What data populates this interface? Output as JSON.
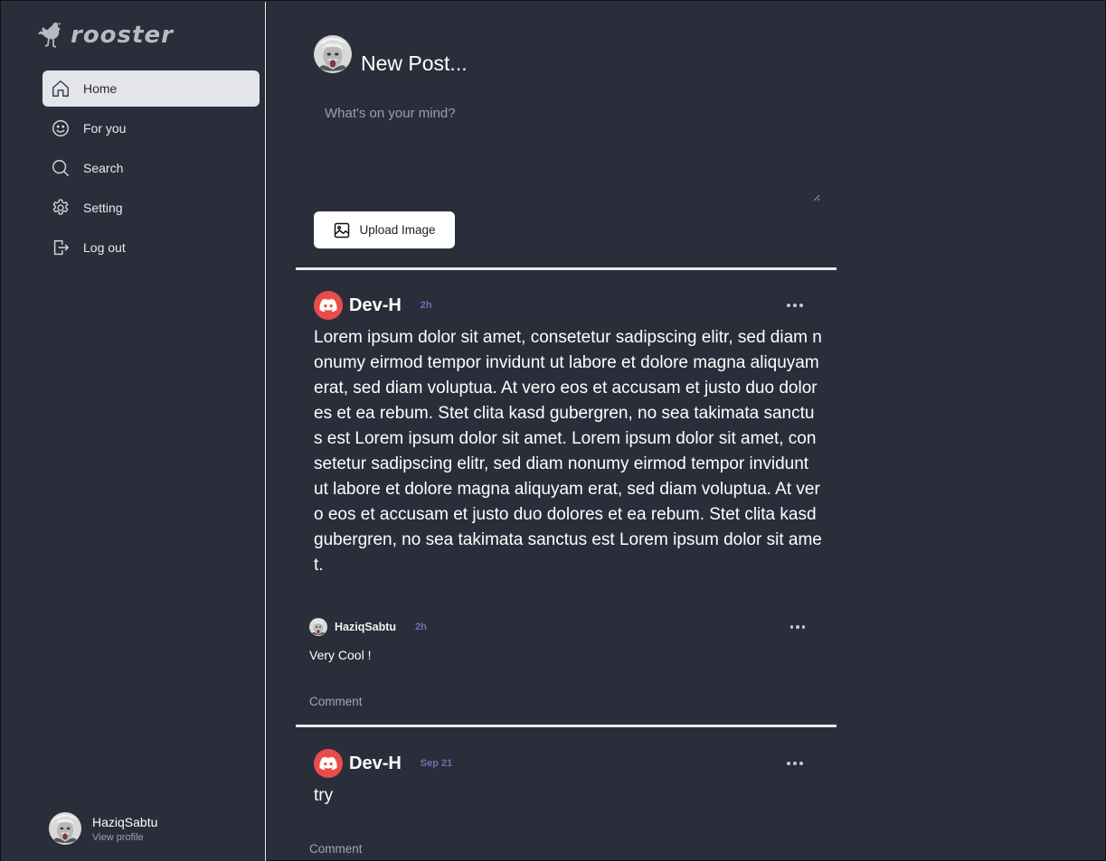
{
  "app": {
    "logo_text": "rooster"
  },
  "sidebar": {
    "items": [
      {
        "label": "Home",
        "icon": "home-icon",
        "active": true
      },
      {
        "label": "For you",
        "icon": "smiley-icon",
        "active": false
      },
      {
        "label": "Search",
        "icon": "search-icon",
        "active": false
      },
      {
        "label": "Setting",
        "icon": "gear-icon",
        "active": false
      },
      {
        "label": "Log out",
        "icon": "logout-icon",
        "active": false
      }
    ],
    "profile": {
      "name": "HaziqSabtu",
      "link_label": "View profile"
    }
  },
  "composer": {
    "title": "New Post...",
    "placeholder": "What's on your mind?",
    "upload_label": "Upload Image"
  },
  "posts": [
    {
      "author": "Dev-H",
      "time": "2h",
      "body": "Lorem ipsum dolor sit amet, consetetur sadipscing elitr, sed diam nonumy eirmod tempor invidunt ut labore et dolore magna aliquyam erat, sed diam voluptua. At vero eos et accusam et justo duo dolores et ea rebum. Stet clita kasd gubergren, no sea takimata sanctus est Lorem ipsum dolor sit amet. Lorem ipsum dolor sit amet, consetetur sadipscing elitr, sed diam nonumy eirmod tempor invidunt ut labore et dolore magna aliquyam erat, sed diam voluptua. At vero eos et accusam et justo duo dolores et ea rebum. Stet clita kasd gubergren, no sea takimata sanctus est Lorem ipsum dolor sit amet.",
      "comments": [
        {
          "author": "HaziqSabtu",
          "time": "2h",
          "text": "Very Cool !"
        }
      ],
      "comment_label": "Comment"
    },
    {
      "author": "Dev-H",
      "time": "Sep 21",
      "body": "try",
      "comment_label": "Comment"
    }
  ],
  "colors": {
    "background": "#2a2e3a",
    "active_nav": "#e4e5ea",
    "discord_red": "#ea4b4b",
    "timestamp": "#6e6fb8"
  }
}
